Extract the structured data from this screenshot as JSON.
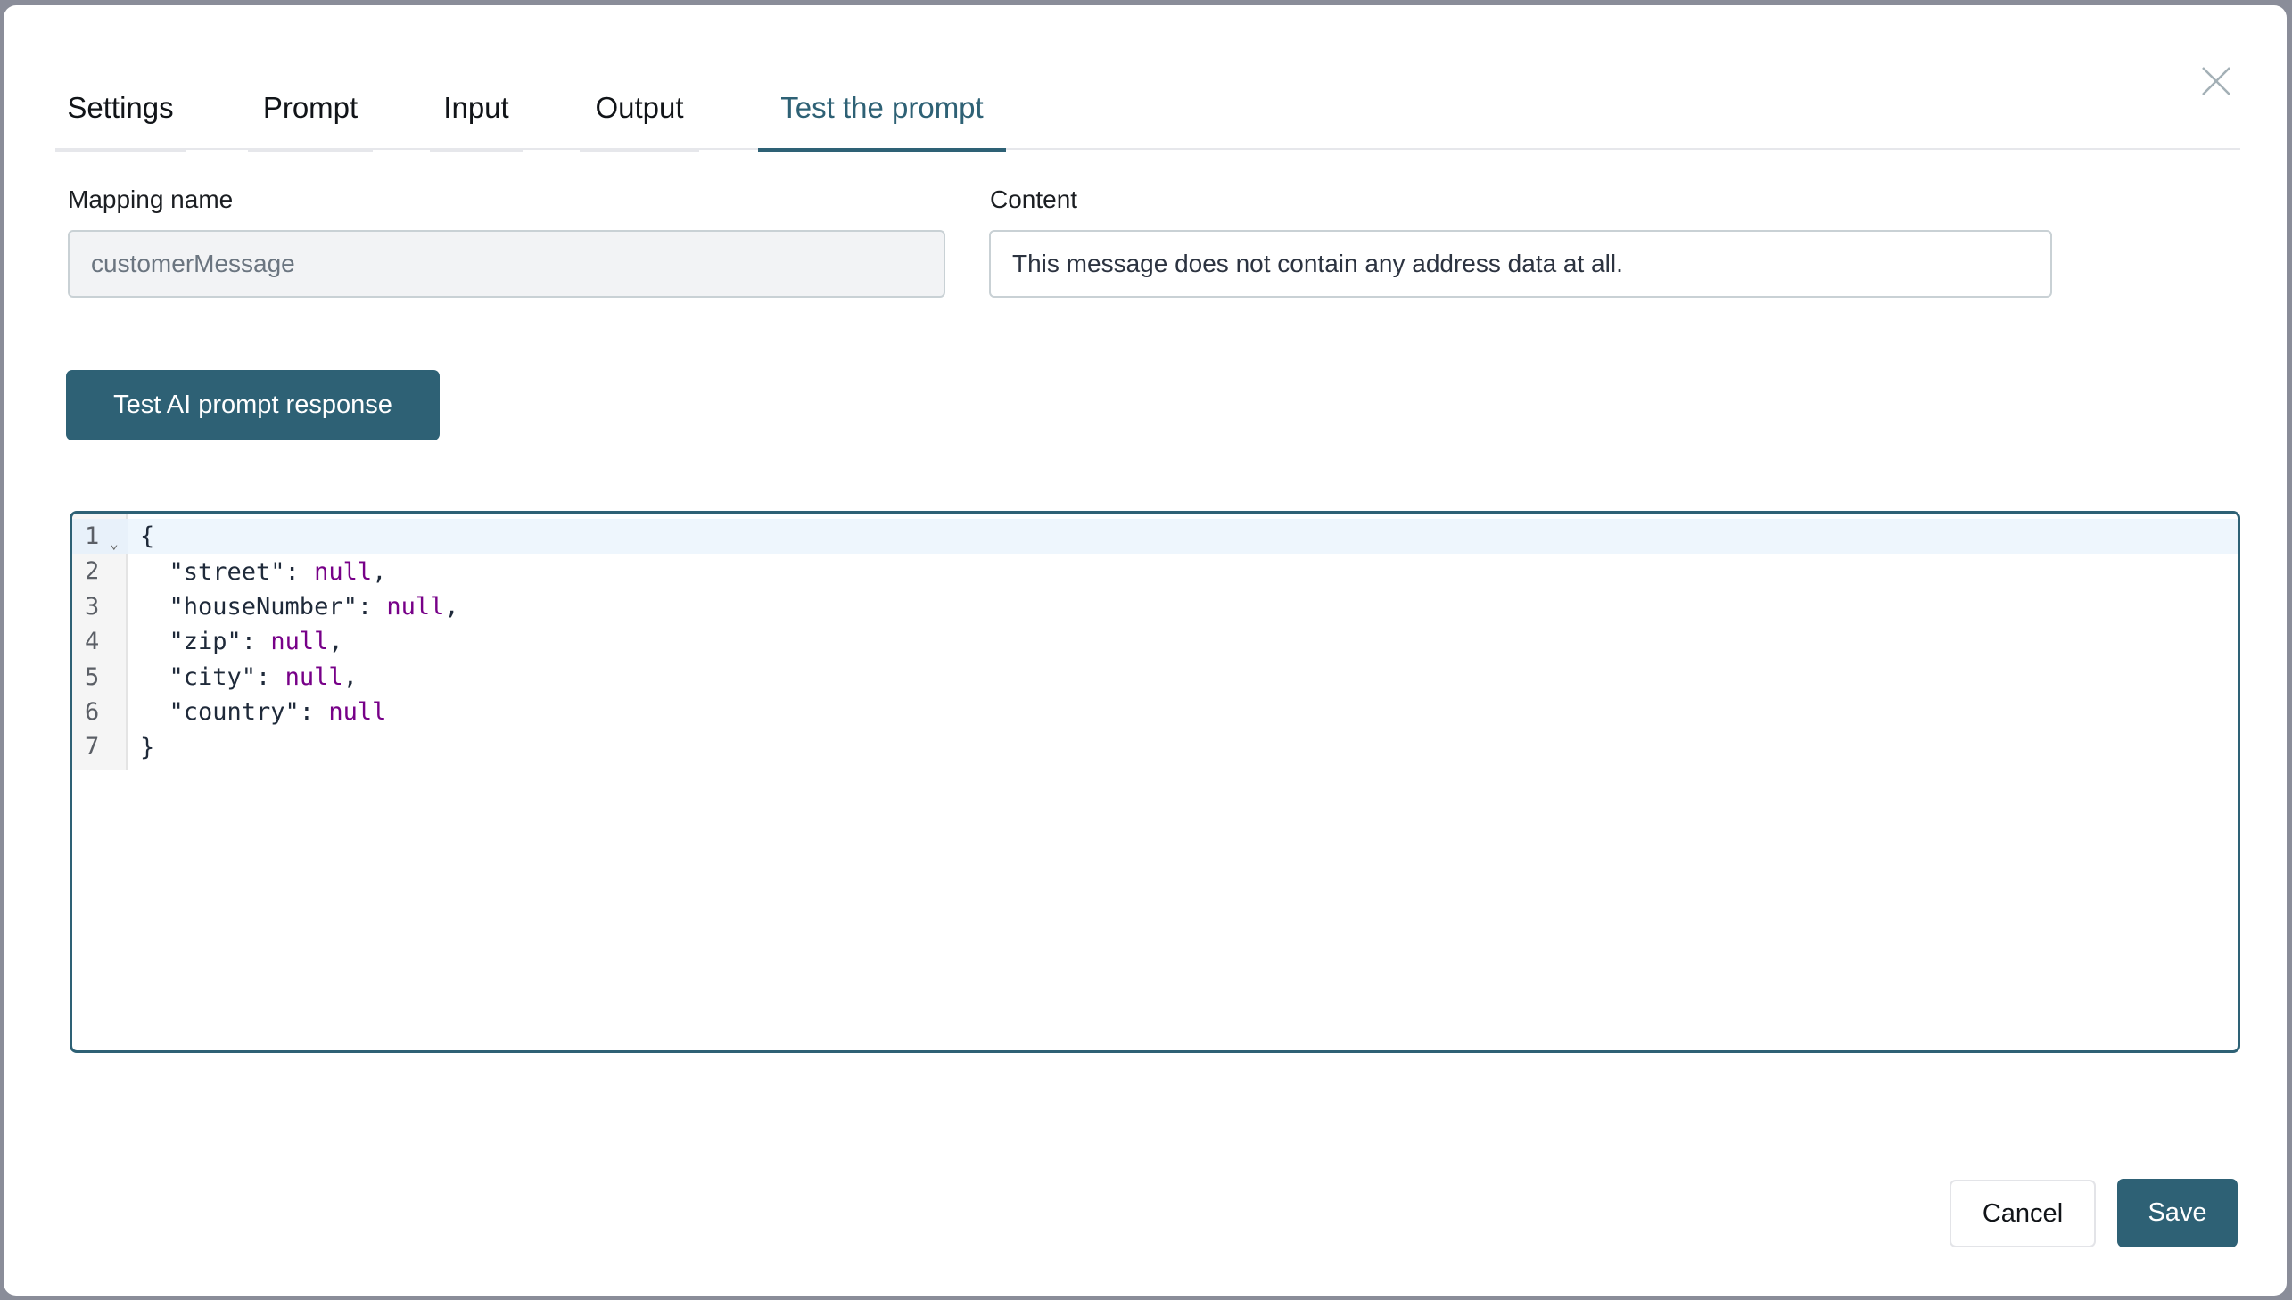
{
  "dialog": {
    "tabs": [
      {
        "label": "Settings",
        "active": false
      },
      {
        "label": "Prompt",
        "active": false
      },
      {
        "label": "Input",
        "active": false
      },
      {
        "label": "Output",
        "active": false
      },
      {
        "label": "Test the prompt",
        "active": true
      }
    ],
    "close_icon": "close-icon"
  },
  "form": {
    "mapping_name": {
      "label": "Mapping name",
      "value": "customerMessage",
      "disabled": true
    },
    "content": {
      "label": "Content",
      "value": "This message does not contain any address data at all."
    }
  },
  "test_button_label": "Test AI prompt response",
  "editor": {
    "language": "json",
    "lines": [
      {
        "no": "1",
        "foldable": true,
        "active": true,
        "tokens": [
          {
            "t": "punc",
            "v": "{"
          }
        ]
      },
      {
        "no": "2",
        "tokens": [
          {
            "t": "key",
            "v": "  \"street\": "
          },
          {
            "t": "null",
            "v": "null"
          },
          {
            "t": "punc",
            "v": ","
          }
        ]
      },
      {
        "no": "3",
        "tokens": [
          {
            "t": "key",
            "v": "  \"houseNumber\": "
          },
          {
            "t": "null",
            "v": "null"
          },
          {
            "t": "punc",
            "v": ","
          }
        ]
      },
      {
        "no": "4",
        "tokens": [
          {
            "t": "key",
            "v": "  \"zip\": "
          },
          {
            "t": "null",
            "v": "null"
          },
          {
            "t": "punc",
            "v": ","
          }
        ]
      },
      {
        "no": "5",
        "tokens": [
          {
            "t": "key",
            "v": "  \"city\": "
          },
          {
            "t": "null",
            "v": "null"
          },
          {
            "t": "punc",
            "v": ","
          }
        ]
      },
      {
        "no": "6",
        "tokens": [
          {
            "t": "key",
            "v": "  \"country\": "
          },
          {
            "t": "null",
            "v": "null"
          }
        ]
      },
      {
        "no": "7",
        "tokens": [
          {
            "t": "punc",
            "v": "}"
          }
        ]
      }
    ]
  },
  "footer": {
    "cancel_label": "Cancel",
    "save_label": "Save"
  },
  "colors": {
    "primary": "#2e6175",
    "null_token": "#770088",
    "backdrop": "#8a8d99"
  }
}
